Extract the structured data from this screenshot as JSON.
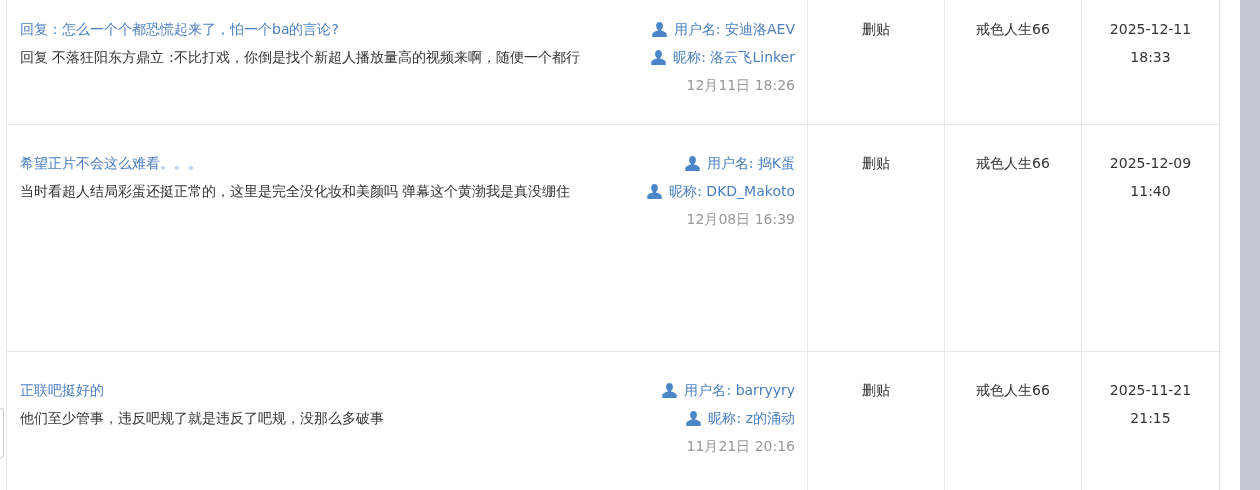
{
  "rows": [
    {
      "title": "回复：怎么一个个都恐慌起来了，怕一个ba的言论?",
      "body": "回复 不落狂阳东方鼎立 :不比打戏，你倒是找个新超人播放量高的视频来啊，随便一个都行",
      "username": "用户名: 安迪洛AEV",
      "nickname": "昵称: 洛云飞Linker",
      "posted": "12月11日 18:26",
      "action": "删贴",
      "operator": "戒色人生66",
      "time": "2025-12-11 18:33"
    },
    {
      "title": "希望正片不会这么难看。。。",
      "body": "当时看超人结局彩蛋还挺正常的，这里是完全没化妆和美颜吗 弹幕这个黄渤我是真没绷住",
      "username": "用户名: 捣K蛋",
      "nickname": "昵称: DKD_Makoto",
      "posted": "12月08日 16:39",
      "action": "删贴",
      "operator": "戒色人生66",
      "time": "2025-12-09 11:40"
    },
    {
      "title": "正联吧挺好的",
      "body": "他们至少管事，违反吧规了就是违反了吧规，没那么多破事",
      "username": "用户名: barryyry",
      "nickname": "昵称: z的涌动",
      "posted": "11月21日 20:16",
      "action": "删贴",
      "operator": "戒色人生66",
      "time": "2025-11-21 21:15"
    }
  ]
}
